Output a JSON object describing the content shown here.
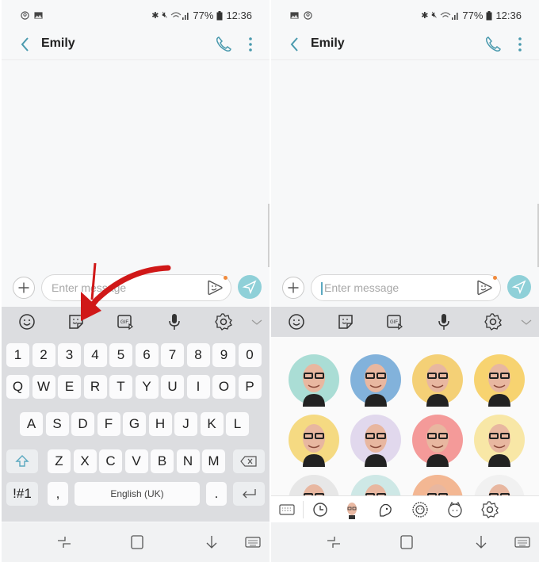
{
  "screens": [
    {
      "status": {
        "battery": "77%",
        "time": "12:36",
        "left_icons": [
          "account-icon",
          "image-icon"
        ]
      },
      "header": {
        "title": "Emily"
      },
      "compose": {
        "placeholder": "Enter message",
        "value": ""
      },
      "keyboard_toolbar": [
        "emoji-icon",
        "sticker-icon",
        "gif-icon",
        "mic-icon",
        "settings-icon",
        "collapse-icon"
      ],
      "keyboard": {
        "row_numbers": [
          "1",
          "2",
          "3",
          "4",
          "5",
          "6",
          "7",
          "8",
          "9",
          "0"
        ],
        "row_top": [
          "Q",
          "W",
          "E",
          "R",
          "T",
          "Y",
          "U",
          "I",
          "O",
          "P"
        ],
        "row_home": [
          "A",
          "S",
          "D",
          "F",
          "G",
          "H",
          "J",
          "K",
          "L"
        ],
        "row_bottom": [
          "Z",
          "X",
          "C",
          "V",
          "B",
          "N",
          "M"
        ],
        "symbols_key": "!#1",
        "comma_key": ",",
        "space_label": "English (UK)",
        "period_key": "."
      },
      "annotation": {
        "type": "red-arrow",
        "points_to": "sticker-icon"
      }
    },
    {
      "status": {
        "battery": "77%",
        "time": "12:36",
        "left_icons": [
          "image-icon",
          "account-icon"
        ]
      },
      "header": {
        "title": "Emily"
      },
      "compose": {
        "placeholder": "Enter message",
        "value": ""
      },
      "keyboard_toolbar": [
        "emoji-icon",
        "sticker-icon",
        "gif-icon",
        "mic-icon",
        "settings-icon",
        "collapse-icon"
      ],
      "stickers": [
        {
          "name": "sticker-laughing-spiral",
          "bg": "#8fd3c8"
        },
        {
          "name": "sticker-wave-clouds",
          "bg": "#5a9ad0"
        },
        {
          "name": "sticker-rainbow",
          "bg": "#f2c24a"
        },
        {
          "name": "sticker-ok",
          "bg": "#f5c542"
        },
        {
          "name": "sticker-pray",
          "bg": "#f3cf5a"
        },
        {
          "name": "sticker-heart",
          "bg": "#d8cce8"
        },
        {
          "name": "sticker-kiss",
          "bg": "#f27a78"
        },
        {
          "name": "sticker-star",
          "bg": "#f7e08a"
        },
        {
          "name": "sticker-cloud-bow",
          "bg": "#e0e0e0"
        },
        {
          "name": "sticker-peek",
          "bg": "#bfe2df"
        },
        {
          "name": "sticker-feather",
          "bg": "#f0a070"
        },
        {
          "name": "sticker-glasses",
          "bg": "#eeeeee"
        }
      ],
      "sticker_tabs": [
        "keyboard-icon",
        "recent-icon",
        "my-emoji-icon",
        "dino-icon",
        "lion-icon",
        "cat-icon",
        "settings-icon"
      ]
    }
  ]
}
